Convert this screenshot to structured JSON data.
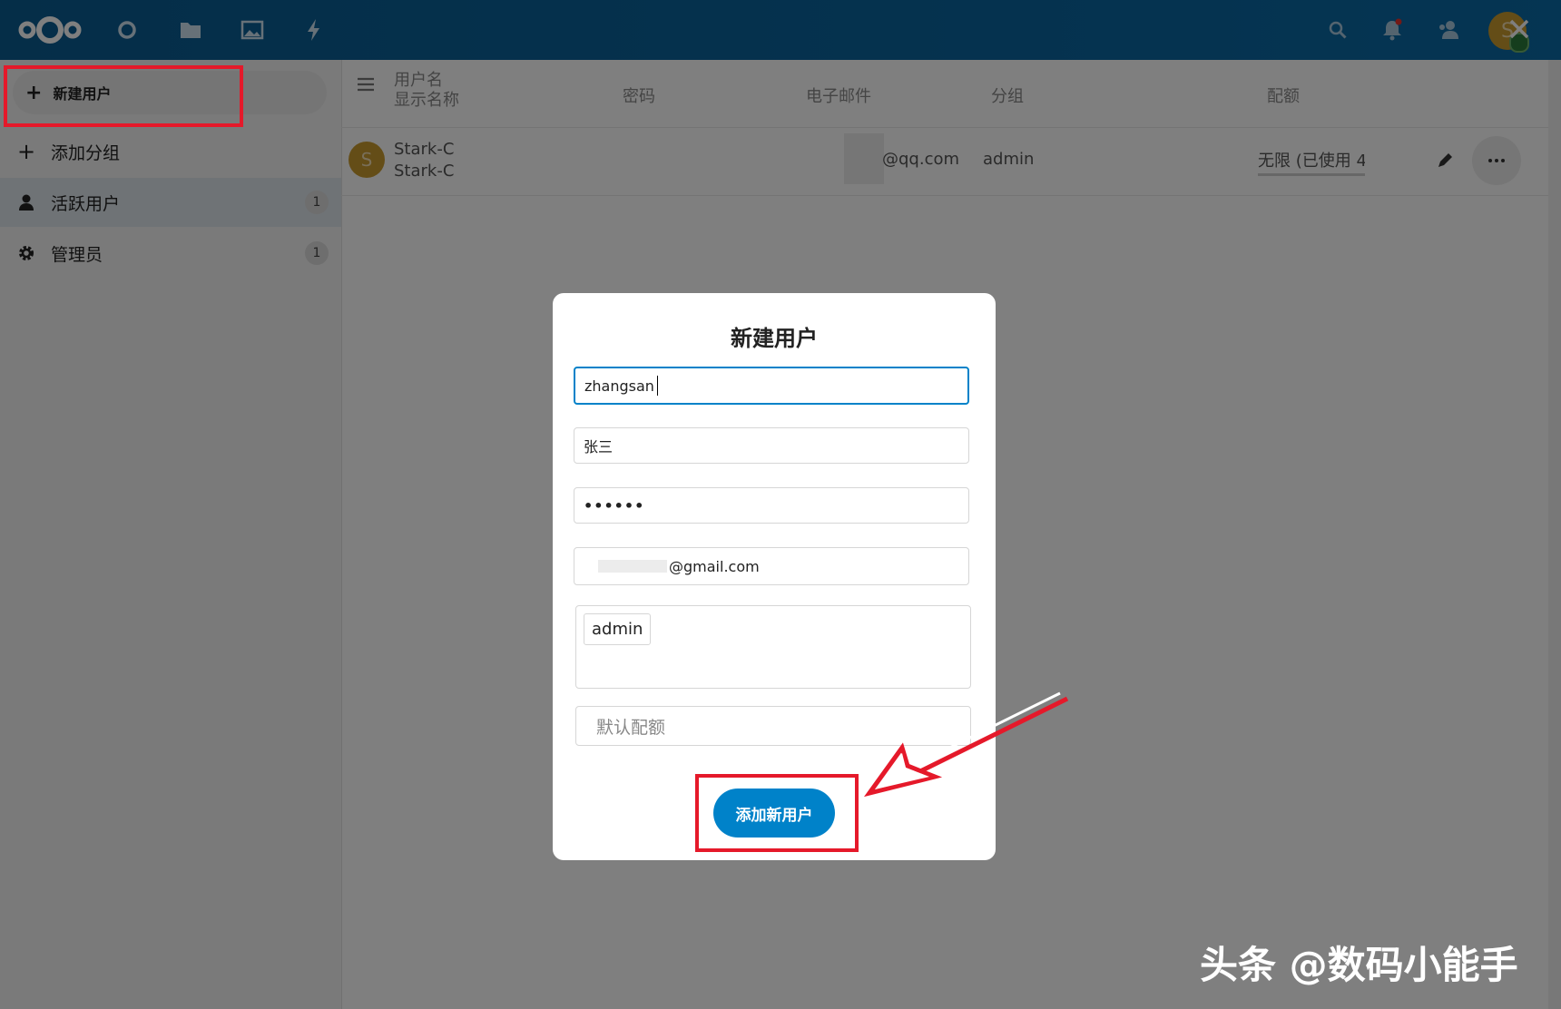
{
  "header": {
    "icons": [
      "nextcloud-logo-icon",
      "dashboard-icon",
      "files-icon",
      "photos-icon",
      "activity-icon",
      "search-icon",
      "notifications-icon",
      "contacts-icon",
      "avatar-icon",
      "close-icon"
    ],
    "avatar_letter": "S"
  },
  "sidebar": {
    "new_user_label": "新建用户",
    "items": [
      {
        "label": "添加分组",
        "count": ""
      },
      {
        "label": "活跃用户",
        "count": "1"
      },
      {
        "label": "管理员",
        "count": "1"
      }
    ]
  },
  "table": {
    "headers": {
      "username": "用户名",
      "display_name": "显示名称",
      "password": "密码",
      "email": "电子邮件",
      "groups": "分组",
      "quota": "配额"
    },
    "rows": [
      {
        "avatar_letter": "S",
        "username": "Stark-C",
        "display_name": "Stark-C",
        "email": "@qq.com",
        "group": "admin",
        "quota": "无限 (已使用 4"
      }
    ]
  },
  "modal": {
    "title": "新建用户",
    "username_value": "zhangsan",
    "display_name_value": "张三",
    "password_value": "••••••",
    "email_value": "@gmail.com",
    "group_chip": "admin",
    "quota_placeholder": "默认配额",
    "submit_label": "添加新用户"
  },
  "watermark": "头条 @数码小能手",
  "colors": {
    "header": "#0b6aa6",
    "primary": "#0082c9",
    "highlight": "#e5192a"
  }
}
